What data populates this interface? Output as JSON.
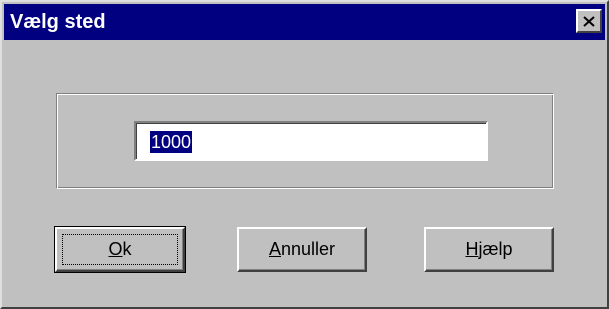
{
  "window": {
    "title": "Vælg sted",
    "close_icon": "close-icon"
  },
  "input": {
    "value": "1000",
    "selected": true
  },
  "buttons": {
    "ok": {
      "mnemonic": "O",
      "rest": "k"
    },
    "cancel": {
      "mnemonic": "A",
      "rest": "nnuller"
    },
    "help": {
      "mnemonic": "H",
      "rest": "jælp"
    }
  },
  "colors": {
    "titlebar": "#000080",
    "face": "#c0c0c0",
    "selection": "#000080"
  }
}
